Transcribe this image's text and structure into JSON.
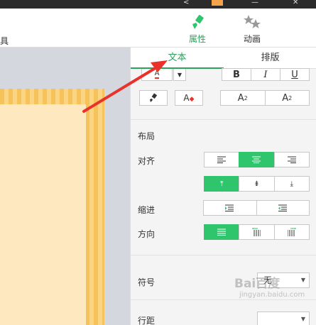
{
  "toolbar": {
    "tool_left_label": "具",
    "attributes_label": "属性",
    "animation_label": "动画"
  },
  "panel": {
    "tabs": [
      {
        "label": "文本"
      },
      {
        "label": "排版"
      }
    ],
    "font_style_buttons": [
      "B",
      "I",
      "U"
    ],
    "script_buttons": [
      {
        "base": "A",
        "sup": "2"
      },
      {
        "base": "A",
        "sub": "2"
      }
    ],
    "section_layout": "布局",
    "align_label": "对齐",
    "indent_label": "缩进",
    "direction_label": "方向",
    "bullet_label": "符号",
    "bullet_value": "无",
    "line_spacing_label": "行距"
  },
  "watermark": {
    "text": "Bai百度",
    "sub": "jingyan.baidu.com"
  },
  "colors": {
    "accent": "#2ec56d",
    "tab_active": "#29a25a",
    "arrow": "#e8322a"
  }
}
